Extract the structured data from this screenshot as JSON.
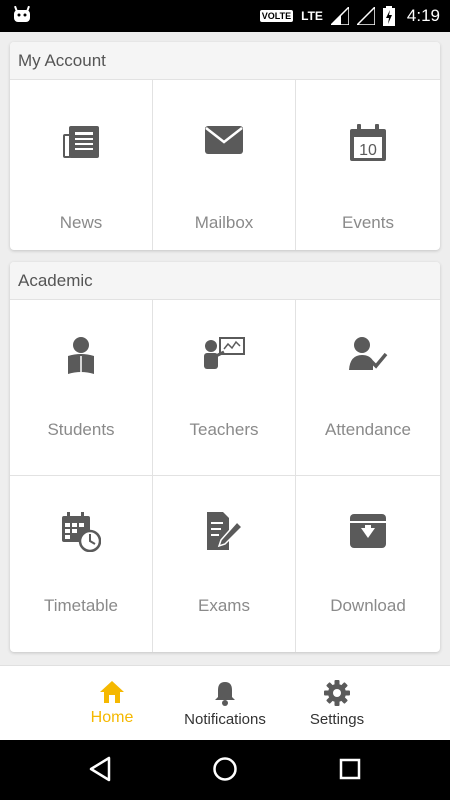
{
  "status_bar": {
    "volte": "VOLTE",
    "network": "LTE",
    "time": "4:19"
  },
  "my_account": {
    "title": "My Account",
    "items": [
      {
        "label": "News",
        "icon": "newspaper-icon"
      },
      {
        "label": "Mailbox",
        "icon": "envelope-icon"
      },
      {
        "label": "Events",
        "icon": "calendar-icon",
        "icon_text": "10"
      }
    ]
  },
  "academic": {
    "title": "Academic",
    "items": [
      {
        "label": "Students",
        "icon": "student-reading-icon"
      },
      {
        "label": "Teachers",
        "icon": "teacher-board-icon"
      },
      {
        "label": "Attendance",
        "icon": "user-check-icon"
      },
      {
        "label": "Timetable",
        "icon": "calendar-clock-icon"
      },
      {
        "label": "Exams",
        "icon": "exam-pencil-icon"
      },
      {
        "label": "Download",
        "icon": "download-box-icon"
      }
    ]
  },
  "bottom_nav": {
    "items": [
      {
        "label": "Home",
        "icon": "home-icon",
        "active": true
      },
      {
        "label": "Notifications",
        "icon": "bell-icon",
        "active": false
      },
      {
        "label": "Settings",
        "icon": "gear-icon",
        "active": false
      }
    ]
  },
  "colors": {
    "accent": "#f5b800",
    "icon": "#5a5a5a",
    "label": "#8a8a8a"
  }
}
